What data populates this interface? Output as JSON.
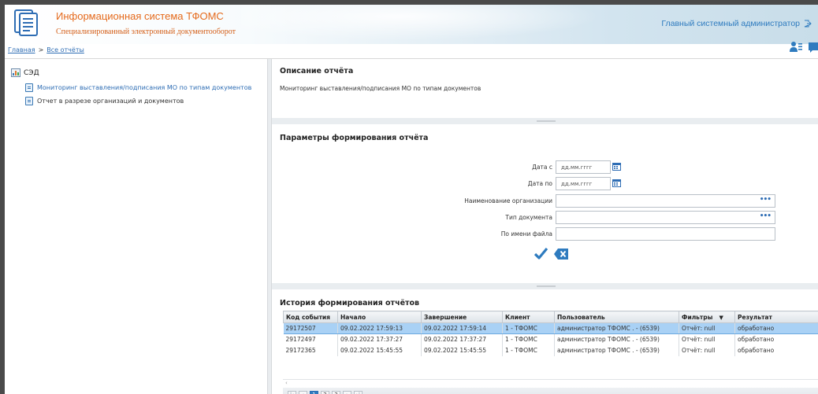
{
  "header": {
    "title": "Информационная система ТФОМС",
    "subtitle": "Специализированный электронный документооборот",
    "user": "Главный системный администратор"
  },
  "breadcrumb": {
    "home": "Главная",
    "separator": ">",
    "current": "Все отчёты"
  },
  "sidebar": {
    "root": "СЭД",
    "items": [
      {
        "label": "Мониторинг выставления/подписания МО по типам документов",
        "active": true
      },
      {
        "label": "Отчет в разрезе организаций и документов",
        "active": false
      }
    ]
  },
  "description": {
    "title": "Описание отчёта",
    "text": "Мониторинг выставления/подписания МО по типам документов"
  },
  "params": {
    "title": "Параметры формирования отчёта",
    "date_from_label": "Дата с",
    "date_from_placeholder": "дд.мм.гггг",
    "date_to_label": "Дата по",
    "date_to_placeholder": "дд.мм.гггг",
    "org_label": "Наименование организации",
    "doc_type_label": "Тип документа",
    "file_label": "По имени файла",
    "picker_dots": "•••"
  },
  "history": {
    "title": "История формирования отчётов",
    "columns": [
      "Код события",
      "Начало",
      "Завершение",
      "Клиент",
      "Пользователь",
      "Фильтры",
      "Результат"
    ],
    "rows": [
      [
        "29172507",
        "09.02.2022 17:59:13",
        "09.02.2022 17:59:14",
        "1 - ТФОМС",
        "администратор ТФОМС . - (6539)",
        "Отчёт: null",
        "обработано"
      ],
      [
        "29172497",
        "09.02.2022 17:37:27",
        "09.02.2022 17:37:27",
        "1 - ТФОМС",
        "администратор ТФОМС . - (6539)",
        "Отчёт: null",
        "обработано"
      ],
      [
        "29172365",
        "09.02.2022 15:45:55",
        "09.02.2022 15:45:55",
        "1 - ТФОМС",
        "администратор ТФОМС . - (6539)",
        "Отчёт: null",
        "обработано"
      ]
    ],
    "selected_row": 0,
    "pages": [
      "1",
      "2",
      "3"
    ],
    "current_page": "1"
  },
  "colors": {
    "accent": "#2e7bbf",
    "title_orange": "#e56a1c",
    "selected_row": "#a9d1f5"
  }
}
